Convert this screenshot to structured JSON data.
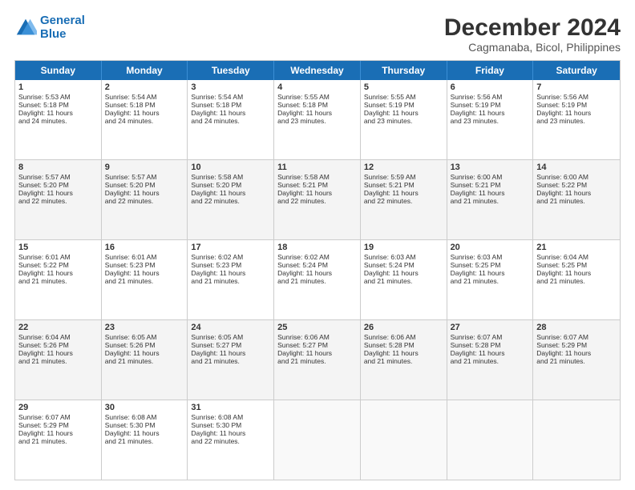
{
  "logo": {
    "line1": "General",
    "line2": "Blue"
  },
  "title": "December 2024",
  "subtitle": "Cagmanaba, Bicol, Philippines",
  "days": [
    "Sunday",
    "Monday",
    "Tuesday",
    "Wednesday",
    "Thursday",
    "Friday",
    "Saturday"
  ],
  "weeks": [
    [
      {
        "num": "1",
        "lines": [
          "Sunrise: 5:53 AM",
          "Sunset: 5:18 PM",
          "Daylight: 11 hours",
          "and 24 minutes."
        ]
      },
      {
        "num": "2",
        "lines": [
          "Sunrise: 5:54 AM",
          "Sunset: 5:18 PM",
          "Daylight: 11 hours",
          "and 24 minutes."
        ]
      },
      {
        "num": "3",
        "lines": [
          "Sunrise: 5:54 AM",
          "Sunset: 5:18 PM",
          "Daylight: 11 hours",
          "and 24 minutes."
        ]
      },
      {
        "num": "4",
        "lines": [
          "Sunrise: 5:55 AM",
          "Sunset: 5:18 PM",
          "Daylight: 11 hours",
          "and 23 minutes."
        ]
      },
      {
        "num": "5",
        "lines": [
          "Sunrise: 5:55 AM",
          "Sunset: 5:19 PM",
          "Daylight: 11 hours",
          "and 23 minutes."
        ]
      },
      {
        "num": "6",
        "lines": [
          "Sunrise: 5:56 AM",
          "Sunset: 5:19 PM",
          "Daylight: 11 hours",
          "and 23 minutes."
        ]
      },
      {
        "num": "7",
        "lines": [
          "Sunrise: 5:56 AM",
          "Sunset: 5:19 PM",
          "Daylight: 11 hours",
          "and 23 minutes."
        ]
      }
    ],
    [
      {
        "num": "8",
        "lines": [
          "Sunrise: 5:57 AM",
          "Sunset: 5:20 PM",
          "Daylight: 11 hours",
          "and 22 minutes."
        ]
      },
      {
        "num": "9",
        "lines": [
          "Sunrise: 5:57 AM",
          "Sunset: 5:20 PM",
          "Daylight: 11 hours",
          "and 22 minutes."
        ]
      },
      {
        "num": "10",
        "lines": [
          "Sunrise: 5:58 AM",
          "Sunset: 5:20 PM",
          "Daylight: 11 hours",
          "and 22 minutes."
        ]
      },
      {
        "num": "11",
        "lines": [
          "Sunrise: 5:58 AM",
          "Sunset: 5:21 PM",
          "Daylight: 11 hours",
          "and 22 minutes."
        ]
      },
      {
        "num": "12",
        "lines": [
          "Sunrise: 5:59 AM",
          "Sunset: 5:21 PM",
          "Daylight: 11 hours",
          "and 22 minutes."
        ]
      },
      {
        "num": "13",
        "lines": [
          "Sunrise: 6:00 AM",
          "Sunset: 5:21 PM",
          "Daylight: 11 hours",
          "and 21 minutes."
        ]
      },
      {
        "num": "14",
        "lines": [
          "Sunrise: 6:00 AM",
          "Sunset: 5:22 PM",
          "Daylight: 11 hours",
          "and 21 minutes."
        ]
      }
    ],
    [
      {
        "num": "15",
        "lines": [
          "Sunrise: 6:01 AM",
          "Sunset: 5:22 PM",
          "Daylight: 11 hours",
          "and 21 minutes."
        ]
      },
      {
        "num": "16",
        "lines": [
          "Sunrise: 6:01 AM",
          "Sunset: 5:23 PM",
          "Daylight: 11 hours",
          "and 21 minutes."
        ]
      },
      {
        "num": "17",
        "lines": [
          "Sunrise: 6:02 AM",
          "Sunset: 5:23 PM",
          "Daylight: 11 hours",
          "and 21 minutes."
        ]
      },
      {
        "num": "18",
        "lines": [
          "Sunrise: 6:02 AM",
          "Sunset: 5:24 PM",
          "Daylight: 11 hours",
          "and 21 minutes."
        ]
      },
      {
        "num": "19",
        "lines": [
          "Sunrise: 6:03 AM",
          "Sunset: 5:24 PM",
          "Daylight: 11 hours",
          "and 21 minutes."
        ]
      },
      {
        "num": "20",
        "lines": [
          "Sunrise: 6:03 AM",
          "Sunset: 5:25 PM",
          "Daylight: 11 hours",
          "and 21 minutes."
        ]
      },
      {
        "num": "21",
        "lines": [
          "Sunrise: 6:04 AM",
          "Sunset: 5:25 PM",
          "Daylight: 11 hours",
          "and 21 minutes."
        ]
      }
    ],
    [
      {
        "num": "22",
        "lines": [
          "Sunrise: 6:04 AM",
          "Sunset: 5:26 PM",
          "Daylight: 11 hours",
          "and 21 minutes."
        ]
      },
      {
        "num": "23",
        "lines": [
          "Sunrise: 6:05 AM",
          "Sunset: 5:26 PM",
          "Daylight: 11 hours",
          "and 21 minutes."
        ]
      },
      {
        "num": "24",
        "lines": [
          "Sunrise: 6:05 AM",
          "Sunset: 5:27 PM",
          "Daylight: 11 hours",
          "and 21 minutes."
        ]
      },
      {
        "num": "25",
        "lines": [
          "Sunrise: 6:06 AM",
          "Sunset: 5:27 PM",
          "Daylight: 11 hours",
          "and 21 minutes."
        ]
      },
      {
        "num": "26",
        "lines": [
          "Sunrise: 6:06 AM",
          "Sunset: 5:28 PM",
          "Daylight: 11 hours",
          "and 21 minutes."
        ]
      },
      {
        "num": "27",
        "lines": [
          "Sunrise: 6:07 AM",
          "Sunset: 5:28 PM",
          "Daylight: 11 hours",
          "and 21 minutes."
        ]
      },
      {
        "num": "28",
        "lines": [
          "Sunrise: 6:07 AM",
          "Sunset: 5:29 PM",
          "Daylight: 11 hours",
          "and 21 minutes."
        ]
      }
    ],
    [
      {
        "num": "29",
        "lines": [
          "Sunrise: 6:07 AM",
          "Sunset: 5:29 PM",
          "Daylight: 11 hours",
          "and 21 minutes."
        ]
      },
      {
        "num": "30",
        "lines": [
          "Sunrise: 6:08 AM",
          "Sunset: 5:30 PM",
          "Daylight: 11 hours",
          "and 21 minutes."
        ]
      },
      {
        "num": "31",
        "lines": [
          "Sunrise: 6:08 AM",
          "Sunset: 5:30 PM",
          "Daylight: 11 hours",
          "and 22 minutes."
        ]
      },
      null,
      null,
      null,
      null
    ]
  ]
}
